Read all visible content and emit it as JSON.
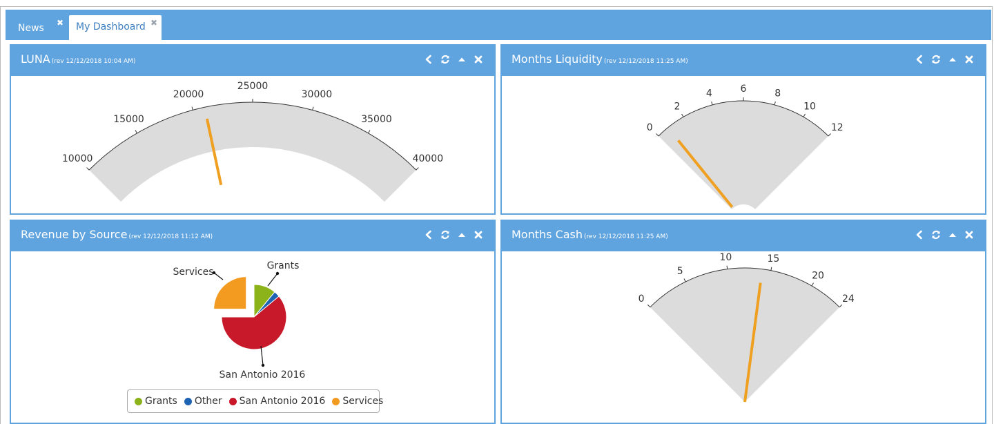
{
  "tabs": [
    {
      "label": "News",
      "active": false
    },
    {
      "label": "My Dashboard",
      "active": true
    }
  ],
  "widgets": {
    "luna": {
      "title": "LUNA",
      "rev": "(rev 12/12/2018 10:04 AM)",
      "gauge": {
        "min": 10000,
        "max": 40000,
        "ticks": [
          "10000",
          "15000",
          "20000",
          "25000",
          "30000",
          "35000",
          "40000"
        ],
        "value": 21000
      }
    },
    "liquidity": {
      "title": "Months Liquidity",
      "rev": "(rev 12/12/2018 11:25 AM)",
      "gauge": {
        "min": 0,
        "max": 12,
        "ticks": [
          "0",
          "2",
          "4",
          "6",
          "8",
          "10",
          "12"
        ],
        "value": 0.8
      }
    },
    "revenue": {
      "title": "Revenue by Source",
      "rev": "(rev 12/12/2018 11:12 AM)",
      "labels": {
        "services": "Services",
        "grants": "Grants",
        "sa2016": "San Antonio 2016"
      },
      "legend": [
        "Grants",
        "Other",
        "San Antonio 2016",
        "Services"
      ]
    },
    "cash": {
      "title": "Months Cash",
      "rev": "(rev 12/12/2018 11:25 AM)",
      "gauge": {
        "min": 0,
        "max": 24,
        "ticks": [
          "0",
          "5",
          "10",
          "15",
          "20",
          "24"
        ],
        "value": 14
      }
    }
  },
  "chart_data": [
    {
      "type": "gauge",
      "title": "LUNA",
      "min": 10000,
      "max": 40000,
      "ticks": [
        10000,
        15000,
        20000,
        25000,
        30000,
        35000,
        40000
      ],
      "value": 21000
    },
    {
      "type": "gauge",
      "title": "Months Liquidity",
      "min": 0,
      "max": 12,
      "ticks": [
        0,
        2,
        4,
        6,
        8,
        10,
        12
      ],
      "value": 0.8
    },
    {
      "type": "pie",
      "title": "Revenue by Source",
      "categories": [
        "Grants",
        "Other",
        "San Antonio 2016",
        "Services"
      ],
      "values": [
        11,
        3,
        61,
        25
      ],
      "colors": [
        "#8db31a",
        "#1f63b3",
        "#c8192a",
        "#f39a21"
      ],
      "legend": "bottom"
    },
    {
      "type": "gauge",
      "title": "Months Cash",
      "min": 0,
      "max": 24,
      "ticks": [
        0,
        5,
        10,
        15,
        20,
        24
      ],
      "value": 14
    }
  ],
  "colors": {
    "header": "#5fa3df",
    "needle": "#f0a020",
    "band": "#dcdcdc",
    "grants": "#8db31a",
    "other": "#1f63b3",
    "sa2016": "#c8192a",
    "services": "#f39a21"
  }
}
